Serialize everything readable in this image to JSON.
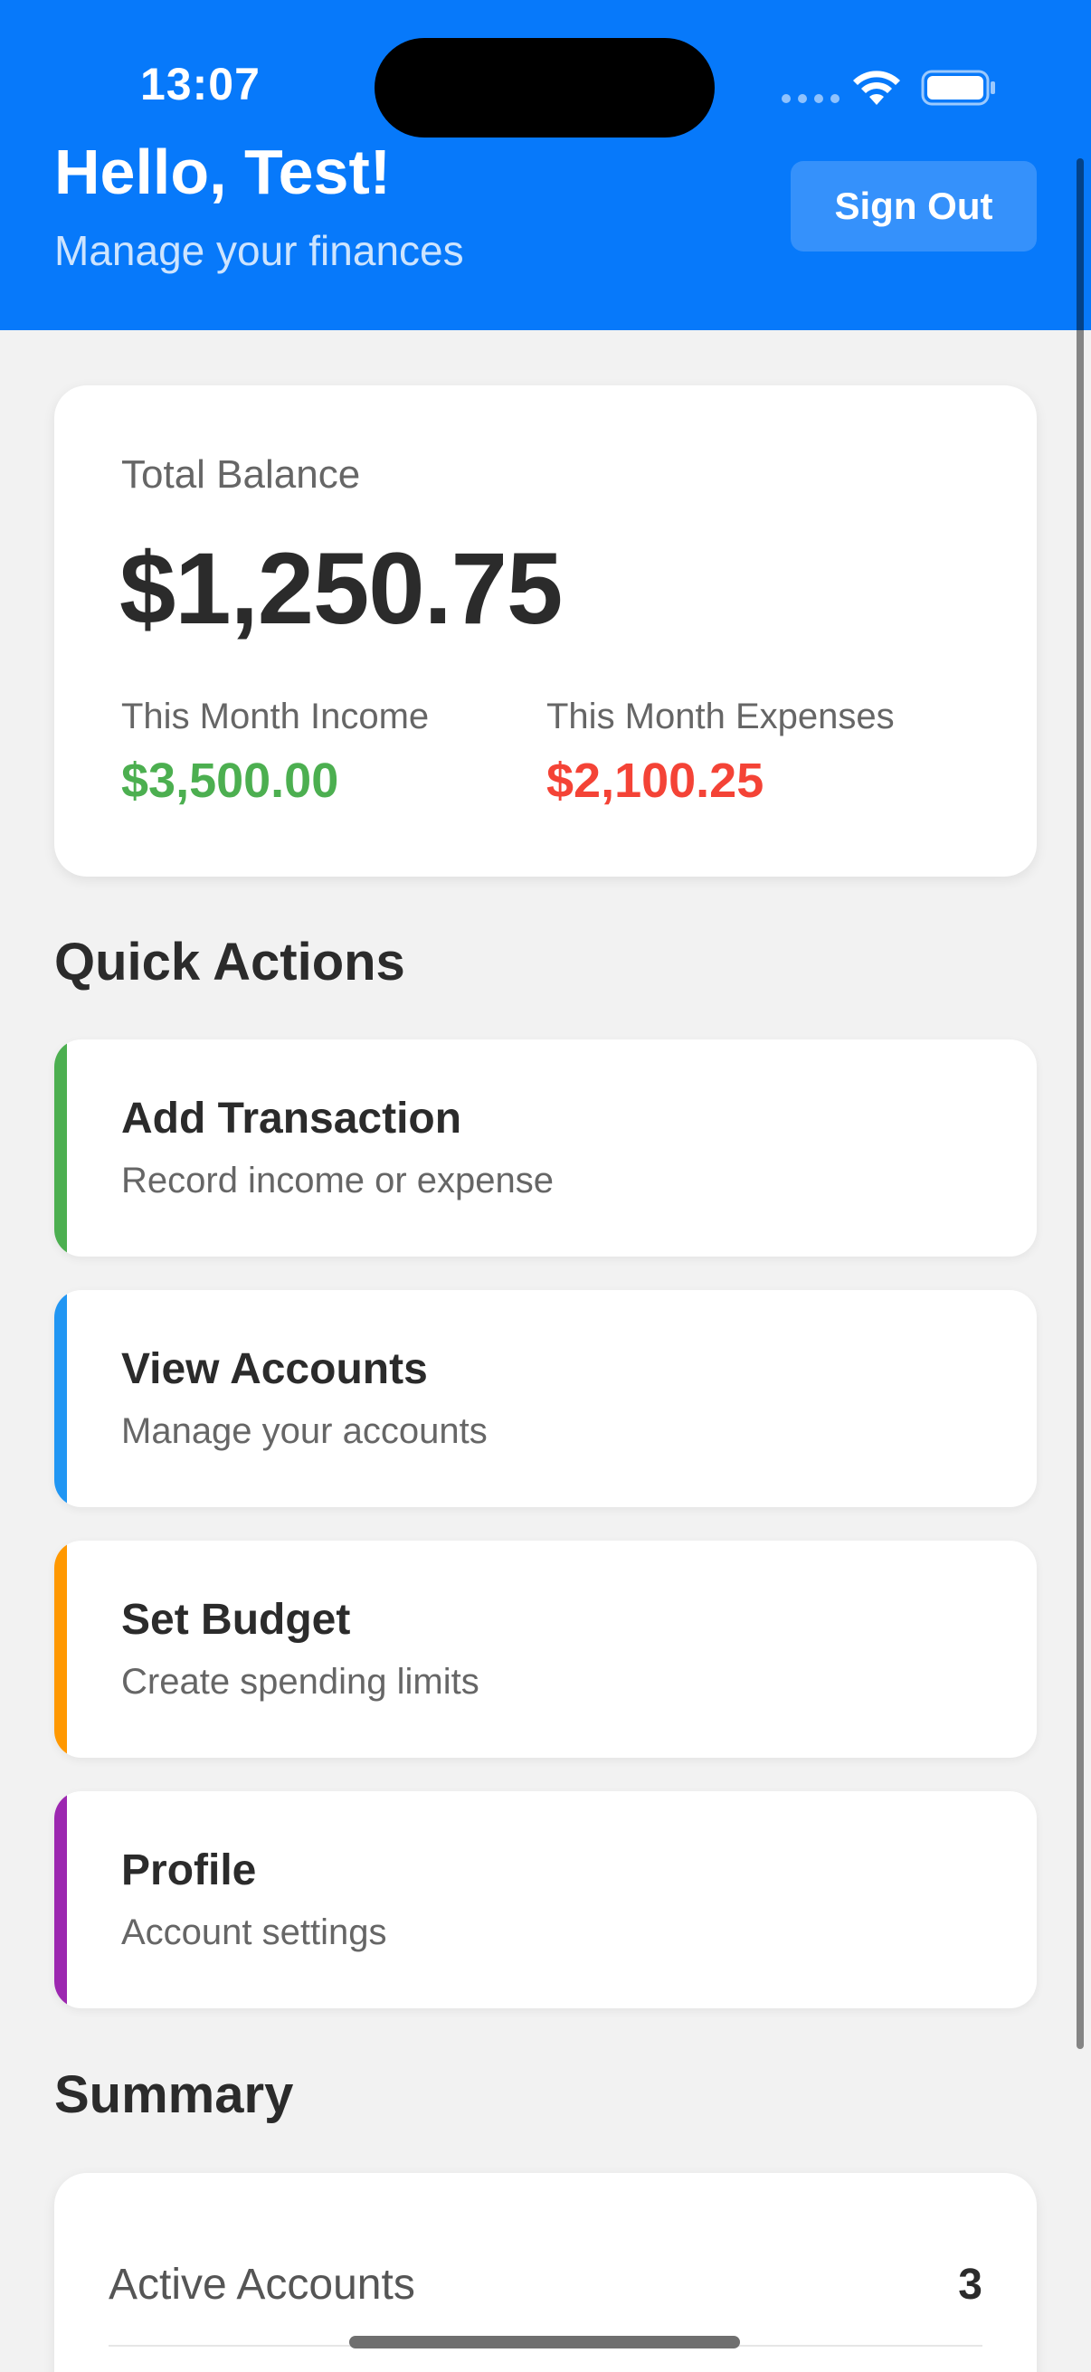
{
  "status_bar": {
    "time": "13:07"
  },
  "header": {
    "greeting": "Hello, Test!",
    "subtitle": "Manage your finances",
    "sign_out_label": "Sign Out",
    "background_color": "#0779fa"
  },
  "balance": {
    "total_label": "Total Balance",
    "total_value": "$1,250.75",
    "income_label": "This Month Income",
    "income_value": "$3,500.00",
    "income_color": "#4caf50",
    "expenses_label": "This Month Expenses",
    "expenses_value": "$2,100.25",
    "expenses_color": "#f44336"
  },
  "quick_actions": {
    "title": "Quick Actions",
    "items": [
      {
        "title": "Add Transaction",
        "subtitle": "Record income or expense",
        "accent": "#4caf50",
        "icon": "none"
      },
      {
        "title": "View Accounts",
        "subtitle": "Manage your accounts",
        "accent": "#2196f3",
        "icon": "none"
      },
      {
        "title": "Set Budget",
        "subtitle": "Create spending limits",
        "accent": "#ff9800",
        "icon": "none"
      },
      {
        "title": "Profile",
        "subtitle": "Account settings",
        "accent": "#9c27b0",
        "icon": "none"
      }
    ]
  },
  "summary": {
    "title": "Summary",
    "rows": [
      {
        "label": "Active Accounts",
        "value": "3"
      }
    ]
  }
}
